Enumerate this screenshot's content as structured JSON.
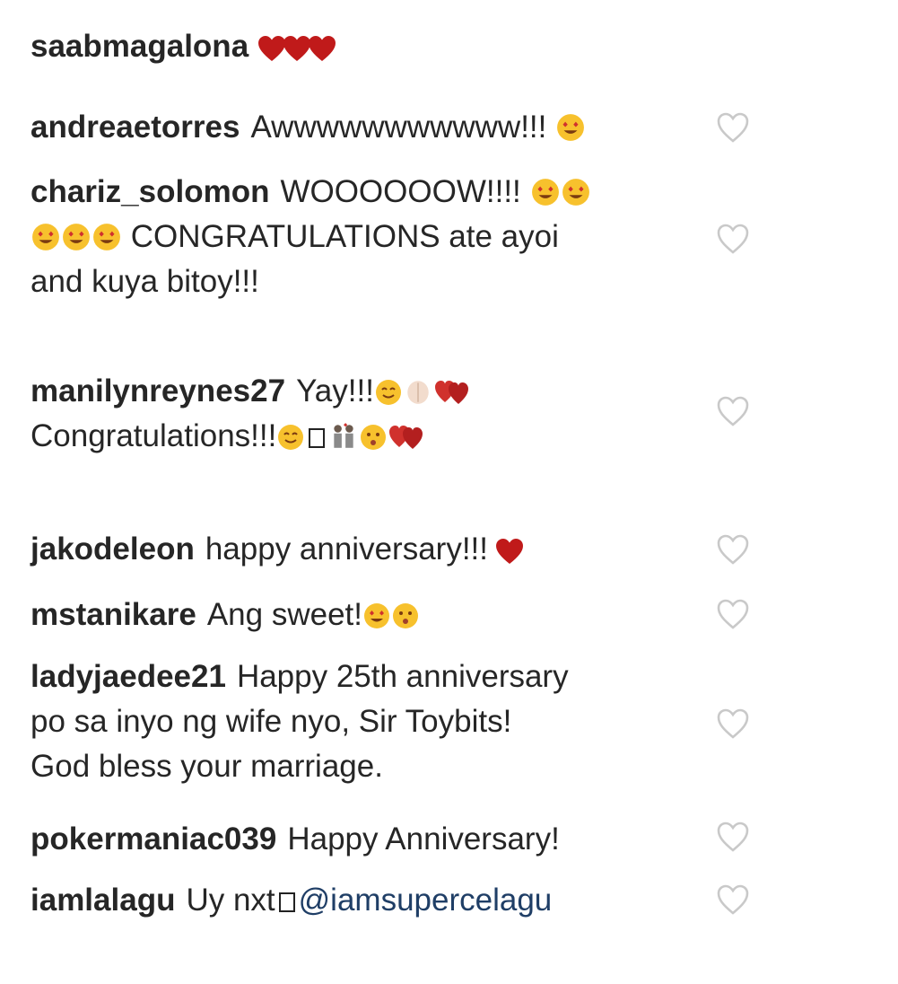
{
  "comments": [
    {
      "user": "saabmagalona",
      "text": ""
    },
    {
      "user": "andreaetorres",
      "text": "Awwwwwwwwwww!!!"
    },
    {
      "user": "chariz_solomon",
      "text_a": "WOOOOOOW!!!!",
      "text_b": "CONGRATULATIONS ate ayoi",
      "text_c": "and kuya bitoy!!!"
    },
    {
      "user": "manilynreynes27",
      "text_a": "Yay!!!",
      "text_b": "Congratulations!!!"
    },
    {
      "user": "jakodeleon",
      "text": "happy anniversary!!!"
    },
    {
      "user": "mstanikare",
      "text": "Ang sweet!"
    },
    {
      "user": "ladyjaedee21",
      "text_a": "Happy 25th anniversary",
      "text_b": "po sa inyo ng wife nyo, Sir Toybits!",
      "text_c": "God bless your marriage."
    },
    {
      "user": "pokermaniac039",
      "text": "Happy Anniversary!"
    },
    {
      "user": "iamlalagu",
      "text": "Uy nxt",
      "mention": "@iamsupercelagu"
    }
  ],
  "icons": {
    "like": "heart-outline-icon",
    "love": "red-heart-icon",
    "smile": "heart-eyes-emoji-icon"
  },
  "colors": {
    "text": "#262626",
    "heart": "#c01a1a",
    "mention": "#1f3e66",
    "like_outline": "#c9c9c9"
  }
}
